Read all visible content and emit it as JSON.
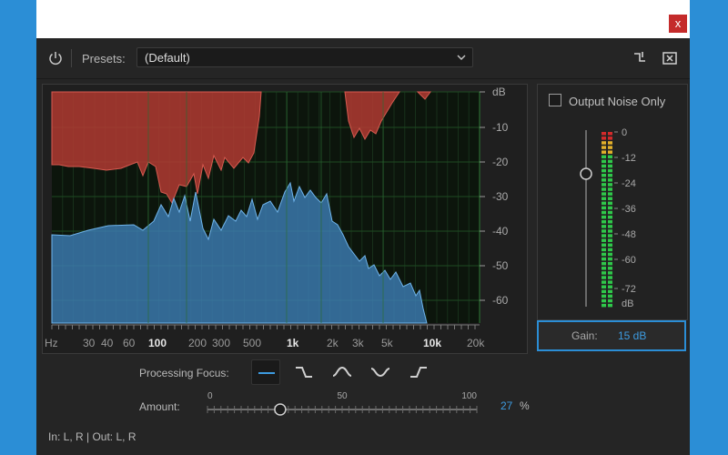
{
  "window": {
    "close_glyph": "x"
  },
  "toolbar": {
    "presets_label": "Presets:",
    "preset_value": "(Default)"
  },
  "spectrum": {
    "db_ticks": [
      "dB",
      "-10",
      "-20",
      "-30",
      "-40",
      "-50",
      "-60"
    ],
    "freq_ticks": [
      "Hz",
      "30",
      "40",
      "60",
      "100",
      "200",
      "300",
      "500",
      "1k",
      "2k",
      "3k",
      "5k",
      "10k",
      "20k"
    ],
    "noise_color": "#b23a32",
    "signal_color": "#3d7eb7"
  },
  "output_noise_only": {
    "label": "Output Noise Only",
    "checked": false
  },
  "meter": {
    "ticks": [
      "0",
      "-12",
      "-24",
      "-36",
      "-48",
      "-60",
      "-72",
      "dB"
    ]
  },
  "gain": {
    "label": "Gain:",
    "value": "15 dB"
  },
  "processing_focus": {
    "label": "Processing Focus:",
    "active_index": 0
  },
  "amount": {
    "label": "Amount:",
    "ticks": [
      "0",
      "50",
      "100"
    ],
    "value": "27",
    "unit": "%",
    "value_fraction": 0.27
  },
  "io": {
    "text": "In: L, R | Out: L, R"
  }
}
